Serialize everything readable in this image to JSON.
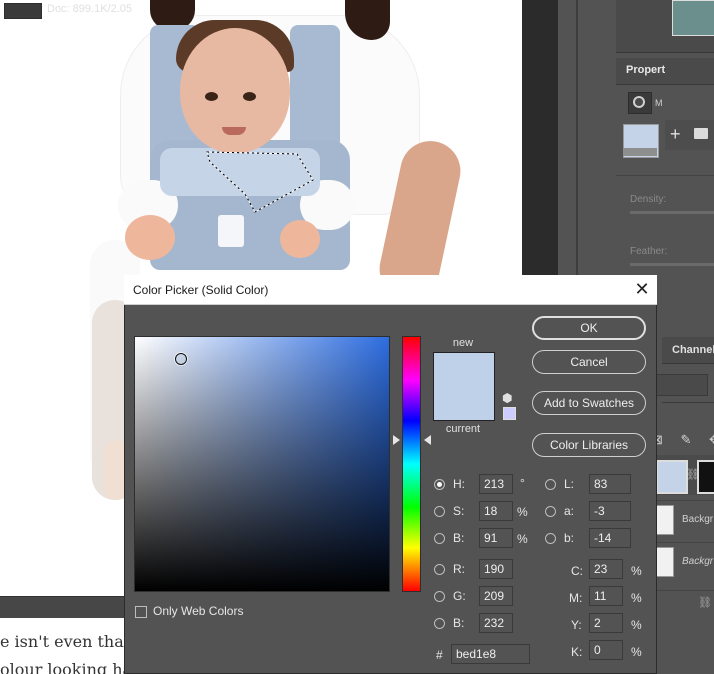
{
  "document": {
    "status_text": "Doc: 899.1K/2.05",
    "web_text_line1": "e isn't even that p",
    "web_text_line2": "olour looking har"
  },
  "panels": {
    "properties_title": "Propert",
    "properties_m": "M",
    "density_label": "Density:",
    "feather_label": "Feather:",
    "channels_tab": "Channels",
    "blend_dropdown": "d",
    "layer_2_name": "Backgr",
    "layer_3_name": "Backgr"
  },
  "picker": {
    "title": "Color Picker (Solid Color)",
    "close_glyph": "✕",
    "new_label": "new",
    "current_label": "current",
    "buttons": {
      "ok": "OK",
      "cancel": "Cancel",
      "add_to_swatches": "Add to Swatches",
      "color_libraries": "Color Libraries"
    },
    "hsb": {
      "h_label": "H:",
      "h_value": "213",
      "h_unit": "°",
      "s_label": "S:",
      "s_value": "18",
      "s_unit": "%",
      "b_label": "B:",
      "b_value": "91",
      "b_unit": "%"
    },
    "rgb": {
      "r_label": "R:",
      "r_value": "190",
      "g_label": "G:",
      "g_value": "209",
      "b_label": "B:",
      "b_value": "232"
    },
    "lab": {
      "l_label": "L:",
      "l_value": "83",
      "a_label": "a:",
      "a_value": "-3",
      "b_label": "b:",
      "b_value": "-14"
    },
    "cmyk": {
      "c_label": "C:",
      "c_value": "23",
      "c_unit": "%",
      "m_label": "M:",
      "m_value": "11",
      "m_unit": "%",
      "y_label": "Y:",
      "y_value": "2",
      "y_unit": "%",
      "k_label": "K:",
      "k_value": "0",
      "k_unit": "%"
    },
    "hex_label": "#",
    "hex_value": "bed1e8",
    "only_web_colors": "Only Web Colors",
    "selected_mode": "H",
    "new_color": "#bed1e8",
    "current_color": "#bed1e8"
  },
  "icons": {
    "plus": "+",
    "link": "⛓",
    "cube": "⬢",
    "locks": "⊠ ✎ ✥"
  }
}
